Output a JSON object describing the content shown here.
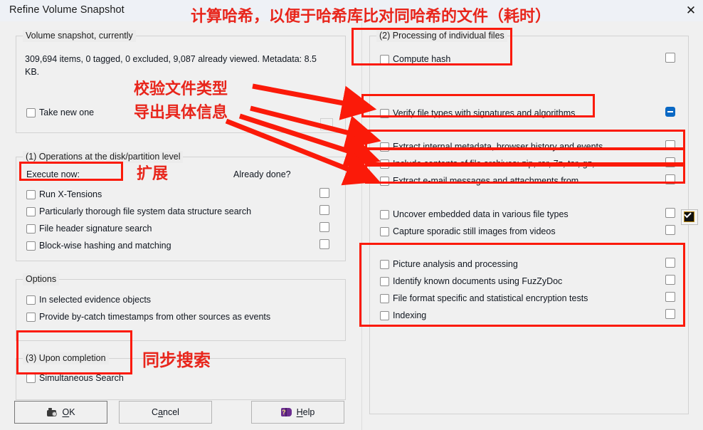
{
  "window": {
    "title": "Refine Volume Snapshot",
    "close_icon": "close-icon",
    "close_label": "✕"
  },
  "left_pane": {
    "volume_group": {
      "caption": "Volume snapshot, currently",
      "status_line1": "309,694 items, 0 tagged, 0 excluded, 9,087 already viewed. Metadata: 8.5",
      "status_line2": "KB.",
      "take_new_one": "Take new one"
    },
    "disk_group": {
      "caption": "(1) Operations at the disk/partition level",
      "execute_now_label": "Execute now:",
      "already_done_label": "Already done?",
      "items": [
        "Run X-Tensions",
        "Particularly thorough file system data structure search",
        "File header signature search",
        "Block-wise hashing and matching"
      ]
    },
    "options_group": {
      "caption": "Options",
      "items": [
        "In selected evidence objects",
        "Provide by-catch timestamps from other sources as events"
      ]
    },
    "completion_group": {
      "caption": "(3) Upon completion",
      "items": [
        "Simultaneous Search"
      ]
    },
    "buttons": {
      "ok": {
        "prefix": "",
        "accel": "O",
        "suffix": "K",
        "icon": "camera-icon"
      },
      "cancel": {
        "prefix": "C",
        "accel": "a",
        "suffix": "ncel",
        "icon": ""
      },
      "help": {
        "prefix": "",
        "accel": "H",
        "suffix": "elp",
        "icon": "book-icon"
      }
    }
  },
  "right_pane": {
    "files_group": {
      "caption": "(2) Processing of individual files",
      "items": [
        {
          "label": "Compute hash",
          "done_state": "unchecked"
        },
        {
          "label": "Verify file types with signatures and algorithms",
          "done_state": "indeterminate"
        },
        {
          "label": "Extract internal metadata, browser history and events",
          "done_state": "unchecked"
        },
        {
          "label": "Include contents of file archives: zip, rar, 7z, tar, gz, ...",
          "done_state": "unchecked"
        },
        {
          "label": "Extract e-mail messages and attachments from...",
          "done_state": "unchecked"
        },
        {
          "label": "Uncover embedded data in various file types",
          "done_state": "unchecked"
        },
        {
          "label": "Capture sporadic still images from videos",
          "done_state": "unchecked"
        },
        {
          "label": "Picture analysis and processing",
          "done_state": "unchecked"
        },
        {
          "label": "Identify known documents using FuzZyDoc",
          "done_state": "unchecked"
        },
        {
          "label": "File format specific and statistical encryption tests",
          "done_state": "unchecked"
        },
        {
          "label": "Indexing",
          "done_state": "unchecked"
        }
      ]
    },
    "floating_checkbox": {
      "name": "enabled-checkbox",
      "state": "checked"
    }
  },
  "annotations": {
    "color": "#e8251b",
    "box_color": "#fb1a09",
    "notes": [
      "计算哈希，以便于哈希库比对同哈希的文件（耗时）",
      "校验文件类型",
      "导出具体信息",
      "扩展",
      "同步搜索"
    ]
  }
}
